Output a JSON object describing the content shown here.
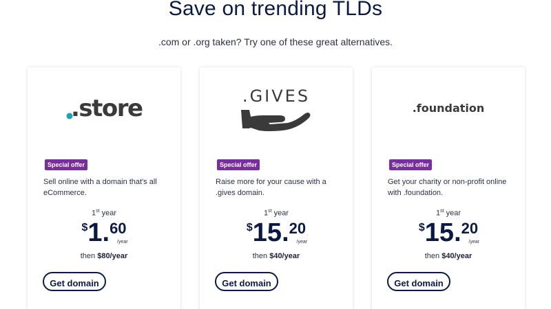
{
  "header": {
    "title": "Save on trending TLDs",
    "subtitle": ".com or .org taken? Try one of these great alternatives."
  },
  "cards": [
    {
      "logo_text": ".store",
      "badge": "Special offer",
      "description": "Sell online with a domain that's all eCommerce.",
      "year_prefix": "1",
      "year_sup": "st",
      "year_suffix": " year",
      "currency": "$",
      "price_whole": "1.",
      "price_cents": "60",
      "per": "/year",
      "then_prefix": "then ",
      "renewal": "$80/year",
      "button": "Get domain"
    },
    {
      "logo_text": ".GIVES",
      "badge": "Special offer",
      "description": "Raise more for your cause with a .gives domain.",
      "year_prefix": "1",
      "year_sup": "st",
      "year_suffix": " year",
      "currency": "$",
      "price_whole": "15.",
      "price_cents": "20",
      "per": "/year",
      "then_prefix": "then ",
      "renewal": "$40/year",
      "button": "Get domain"
    },
    {
      "logo_text": ".foundation",
      "badge": "Special offer",
      "description": "Get your charity or non-profit online with .foundation.",
      "year_prefix": "1",
      "year_sup": "st",
      "year_suffix": " year",
      "currency": "$",
      "price_whole": "15.",
      "price_cents": "20",
      "per": "/year",
      "then_prefix": "then ",
      "renewal": "$40/year",
      "button": "Get domain"
    }
  ],
  "colors": {
    "brand_navy": "#0b1a45",
    "badge_purple": "#7a2e9e",
    "store_dot": "#1aa4b8"
  },
  "icons": {
    "gives_logo": "open-hand-icon"
  }
}
